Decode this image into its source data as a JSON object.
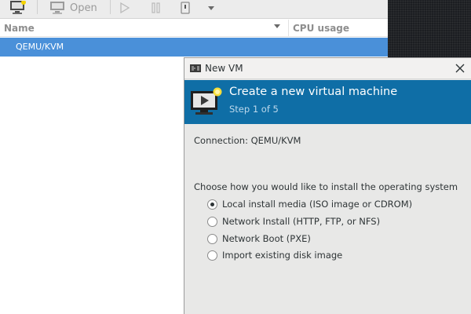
{
  "manager": {
    "toolbar": {
      "open_label": "Open"
    },
    "columns": {
      "name": "Name",
      "cpu_usage": "CPU usage"
    },
    "rows": [
      {
        "name": "QEMU/KVM"
      }
    ]
  },
  "dialog": {
    "title": "New VM",
    "banner_title": "Create a new virtual machine",
    "banner_step": "Step 1 of 5",
    "connection_label": "Connection: QEMU/KVM",
    "install_question": "Choose how you would like to install the operating system",
    "options": [
      {
        "label": "Local install media (ISO image or CDROM)",
        "selected": true
      },
      {
        "label": "Network Install (HTTP, FTP, or NFS)",
        "selected": false
      },
      {
        "label": "Network Boot (PXE)",
        "selected": false
      },
      {
        "label": "Import existing disk image",
        "selected": false
      }
    ]
  },
  "colors": {
    "selection": "#4a90d9",
    "banner": "#0f6ea6",
    "dialog_bg": "#e8e8e7"
  }
}
